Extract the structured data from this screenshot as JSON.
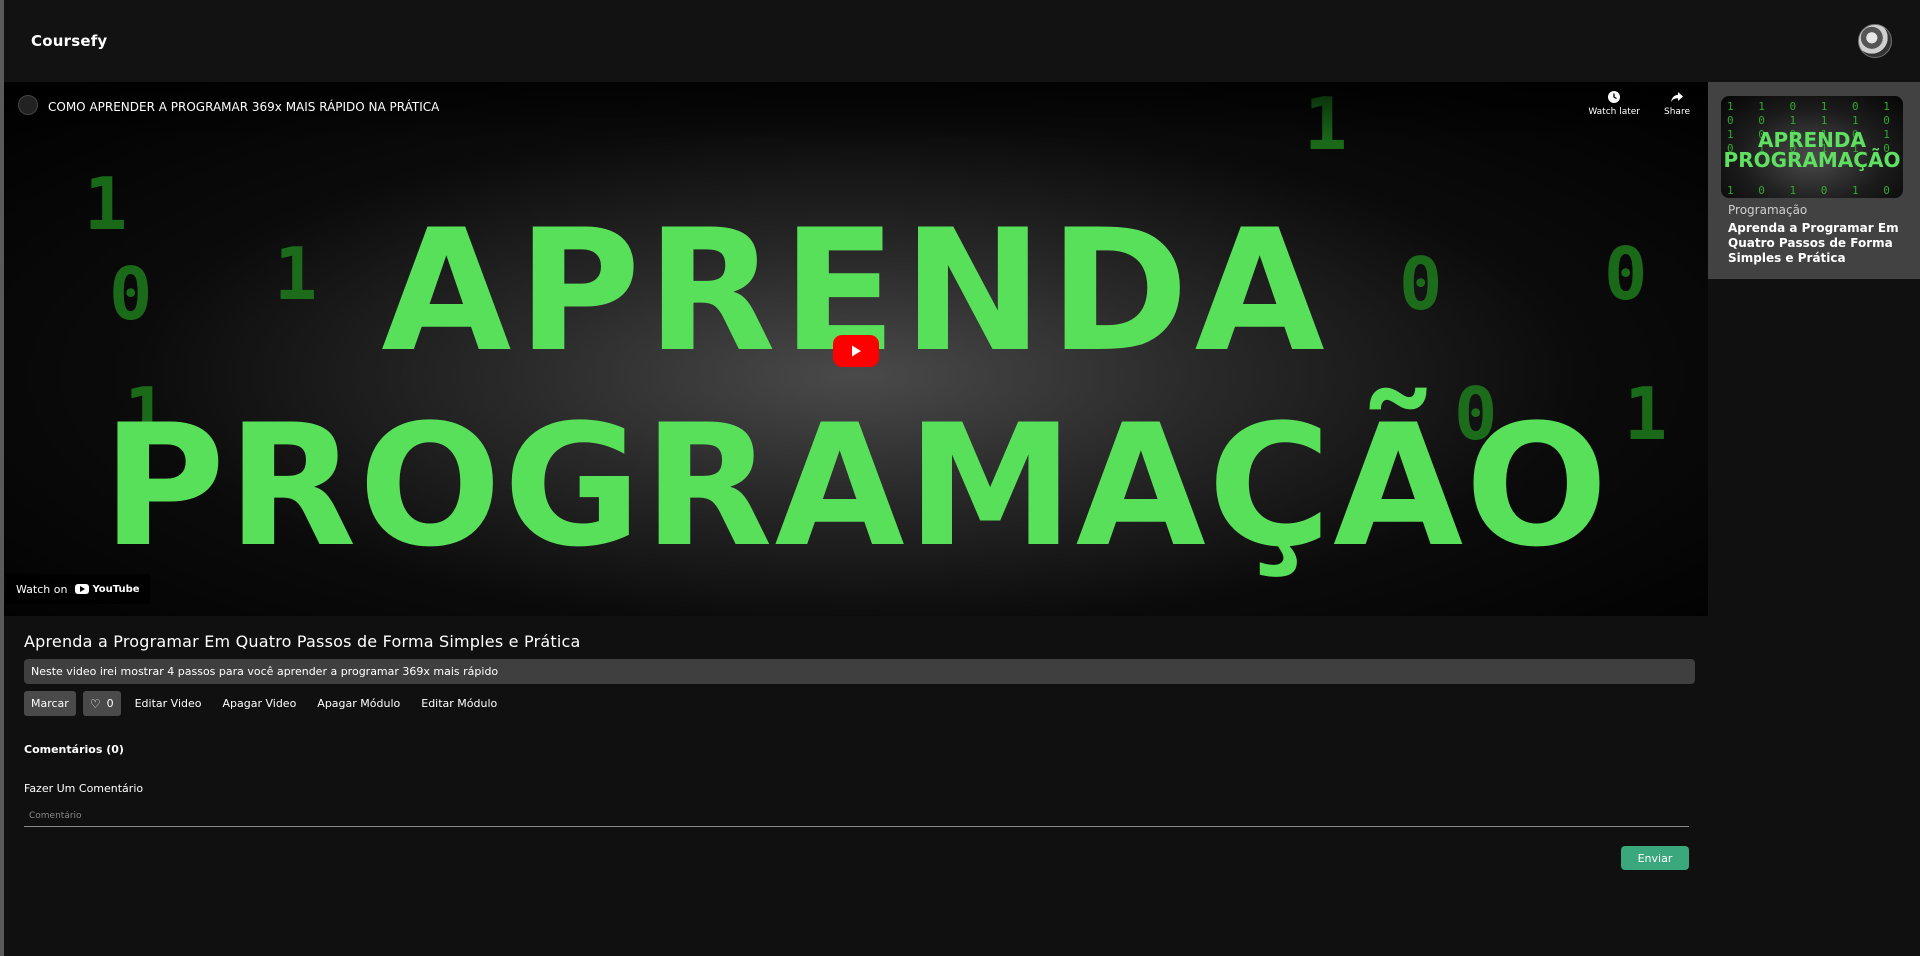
{
  "header": {
    "brand": "Coursefy"
  },
  "video": {
    "title": "COMO APRENDER A PROGRAMAR 369x MAIS RÁPIDO NA PRÁTICA",
    "watch_later": "Watch later",
    "share": "Share",
    "watch_on": "Watch on",
    "youtube": "YouTube",
    "overlay_line1": "APRENDA",
    "overlay_line2": "PROGRAMAÇÃO"
  },
  "lesson": {
    "title": "Aprenda a Programar Em Quatro Passos de Forma Simples e Prática",
    "description": "Neste video irei mostrar 4 passos para você aprender a programar 369x mais rápido"
  },
  "actions": {
    "mark": "Marcar",
    "likes": "0",
    "edit_video": "Editar Video",
    "delete_video": "Apagar Video",
    "delete_module": "Apagar Módulo",
    "edit_module": "Editar Módulo"
  },
  "comments": {
    "heading": "Comentários (0)",
    "make_comment": "Fazer Um Comentário",
    "placeholder": "Comentário",
    "send": "Enviar"
  },
  "sidebar": {
    "items": [
      {
        "category": "Programação",
        "title": "Aprenda a Programar Em Quatro Passos de Forma Simples e Prática",
        "thumb_line1": "APRENDA",
        "thumb_line2": "PROGRAMAÇÃO"
      }
    ]
  },
  "colors": {
    "accent_green": "#3aa77c",
    "neon_green": "#59e05a",
    "youtube_red": "#ff0000"
  }
}
